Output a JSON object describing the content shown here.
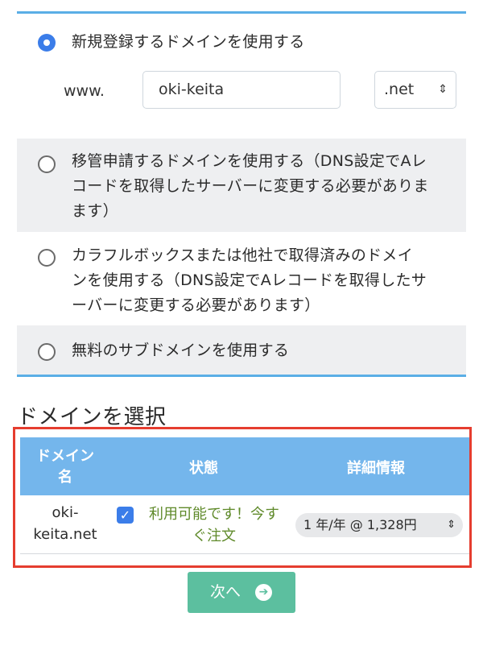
{
  "options": {
    "register_new": {
      "label": "新規登録するドメインを使用する",
      "selected": true
    },
    "www_prefix": "www.",
    "domain_input_value": "oki-keita",
    "tld_selected": ".net",
    "transfer": {
      "label_lines": [
        "移管申請するドメインを使用する（DNS設定でAレ",
        "コードを取得したサーバーに変更する必要がありま",
        "ます）"
      ],
      "selected": false
    },
    "owned": {
      "label_lines": [
        "カラフルボックスまたは他社で取得済みのドメイ",
        "ンを使用する（DNS設定でAレコードを取得したサ",
        "ーバーに変更する必要があります）"
      ],
      "selected": false
    },
    "subdomain": {
      "label": "無料のサブドメインを使用する",
      "selected": false
    }
  },
  "domain_select": {
    "title": "ドメインを選択",
    "headers": {
      "name_lines": [
        "ドメイン",
        "名"
      ],
      "status": "状態",
      "detail": "詳細情報"
    },
    "rows": [
      {
        "name_lines": [
          "oki-",
          "keita.net"
        ],
        "checked": true,
        "status_lines": [
          "利用可能です！今す",
          "ぐ注文"
        ],
        "period": "1 年/年 @ 1,328円"
      }
    ]
  },
  "next_button": {
    "label": "次へ",
    "icon": "arrow-right-circle-icon"
  },
  "colors": {
    "accent_line": "#5aaee6",
    "table_header": "#74b6ec",
    "highlight_border": "#e53d2f",
    "radio_checked": "#3b7de9",
    "status_green": "#5f8a2a",
    "next_button": "#5cbf9f"
  }
}
